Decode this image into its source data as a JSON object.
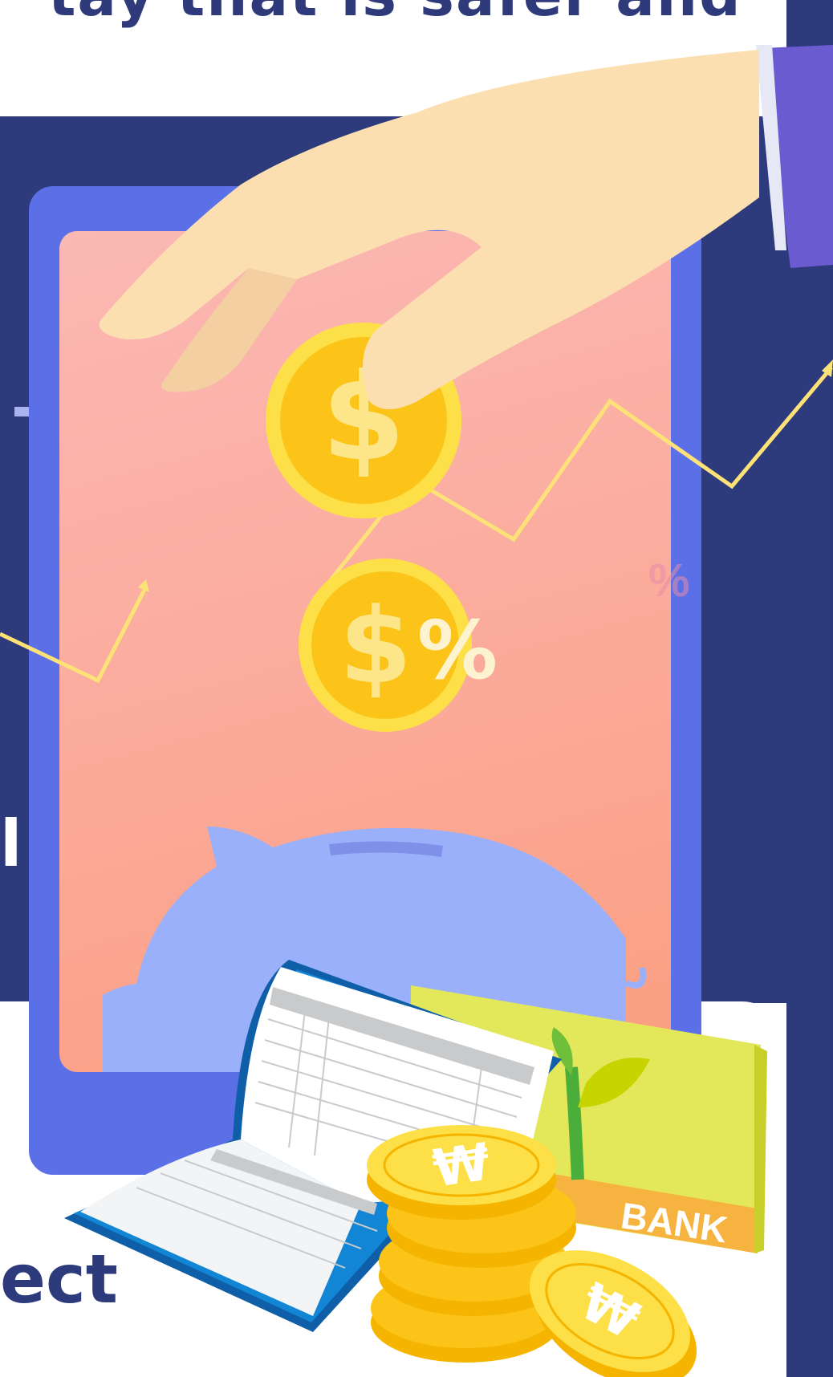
{
  "heading_fragment": "tay that is safer and",
  "side_fragment": "l",
  "bottom_fragment": "ect",
  "coin_symbol": "$",
  "percent_symbol": "%",
  "won_symbol": "₩",
  "bank_label": "BANK",
  "colors": {
    "navy": "#2d3a7c",
    "phone": "#5b70e6",
    "coin": "#fcc419",
    "piggy": "#9bb0fb",
    "trend_line": "#fde277",
    "bank_book": "#e3e85a",
    "bank_stripe": "#f6b33f",
    "sleeve": "#6a5bd0",
    "hand": "#fbdfb0"
  },
  "icons": [
    "plus-icon",
    "dollar-coin-icon",
    "dollar-percent-coin-icon",
    "piggy-bank-icon",
    "bankbook-icon",
    "open-ledger-icon",
    "won-coin-stack-icon",
    "hand-icon",
    "trend-arrow-icon",
    "sprout-icon"
  ]
}
